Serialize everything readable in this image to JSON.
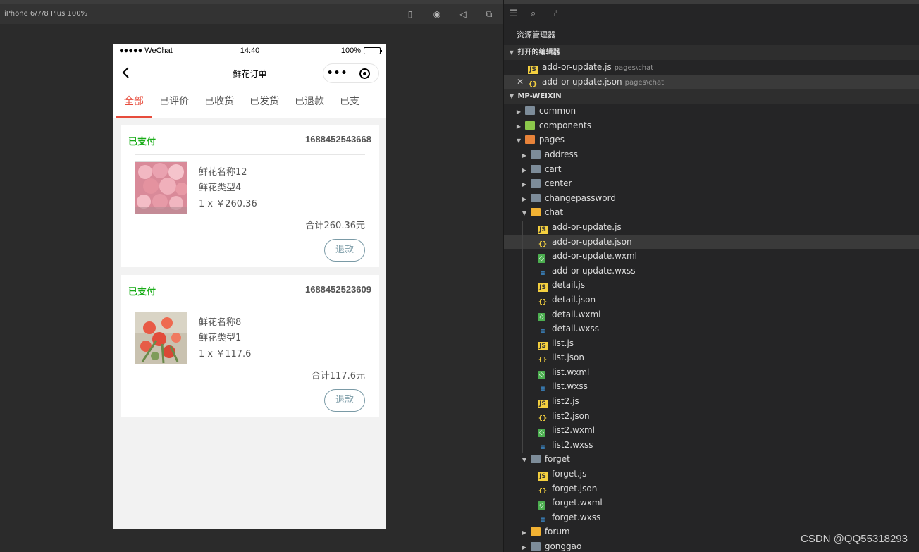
{
  "simulator": {
    "device_label": "iPhone 6/7/8 Plus 100%",
    "tools": [
      "phone-icon",
      "record-icon",
      "volume-icon",
      "window-icon"
    ]
  },
  "phone": {
    "status_bar": {
      "carrier": "●●●●● WeChat",
      "time": "14:40",
      "battery": "100%",
      "battery_level": 1.0
    },
    "nav": {
      "title": "鲜花订单",
      "capsule_more": "•••"
    },
    "tabs": [
      "全部",
      "已评价",
      "已收货",
      "已发货",
      "已退款",
      "已支"
    ],
    "active_tab": 0,
    "orders": [
      {
        "status": "已支付",
        "order_no": "1688452543668",
        "name": "鲜花名称12",
        "type": "鲜花类型4",
        "qty_price": "1 x ￥260.36",
        "total": "合计260.36元",
        "refund": "退款"
      },
      {
        "status": "已支付",
        "order_no": "1688452523609",
        "name": "鲜花名称8",
        "type": "鲜花类型1",
        "qty_price": "1 x ￥117.6",
        "total": "合计117.6元",
        "refund": "退款"
      }
    ]
  },
  "explorer": {
    "title": "资源管理器",
    "open_editors_label": "打开的编辑器",
    "open_editors": [
      {
        "name": "add-or-update.js",
        "path": "pages\\chat"
      },
      {
        "name": "add-or-update.json",
        "path": "pages\\chat"
      }
    ],
    "project_label": "MP-WEIXIN",
    "tree": [
      {
        "name": "common",
        "kind": "folder"
      },
      {
        "name": "components",
        "kind": "folder"
      },
      {
        "name": "pages",
        "kind": "folder"
      },
      {
        "name": "address",
        "kind": "folder"
      },
      {
        "name": "cart",
        "kind": "folder"
      },
      {
        "name": "center",
        "kind": "folder"
      },
      {
        "name": "changepassword",
        "kind": "folder"
      },
      {
        "name": "chat",
        "kind": "folder"
      },
      {
        "name": "add-or-update.js",
        "kind": "js"
      },
      {
        "name": "add-or-update.json",
        "kind": "json"
      },
      {
        "name": "add-or-update.wxml",
        "kind": "wxml"
      },
      {
        "name": "add-or-update.wxss",
        "kind": "wxss"
      },
      {
        "name": "detail.js",
        "kind": "js"
      },
      {
        "name": "detail.json",
        "kind": "json"
      },
      {
        "name": "detail.wxml",
        "kind": "wxml"
      },
      {
        "name": "detail.wxss",
        "kind": "wxss"
      },
      {
        "name": "list.js",
        "kind": "js"
      },
      {
        "name": "list.json",
        "kind": "json"
      },
      {
        "name": "list.wxml",
        "kind": "wxml"
      },
      {
        "name": "list.wxss",
        "kind": "wxss"
      },
      {
        "name": "list2.js",
        "kind": "js"
      },
      {
        "name": "list2.json",
        "kind": "json"
      },
      {
        "name": "list2.wxml",
        "kind": "wxml"
      },
      {
        "name": "list2.wxss",
        "kind": "wxss"
      },
      {
        "name": "forget",
        "kind": "folder"
      },
      {
        "name": "forget.js",
        "kind": "js"
      },
      {
        "name": "forget.json",
        "kind": "json"
      },
      {
        "name": "forget.wxml",
        "kind": "wxml"
      },
      {
        "name": "forget.wxss",
        "kind": "wxss"
      },
      {
        "name": "forum",
        "kind": "folder"
      },
      {
        "name": "gonggao",
        "kind": "folder"
      }
    ]
  },
  "watermark": "CSDN @QQ55318293"
}
